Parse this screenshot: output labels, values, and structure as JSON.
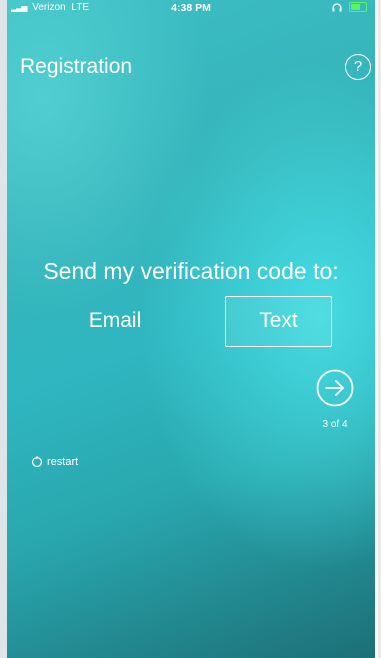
{
  "status_bar": {
    "carrier": "Verizon",
    "network": "LTE",
    "time": "4:38 PM",
    "signal_icon": "signal-bars-icon",
    "headphones_icon": "headphones-icon",
    "battery_icon": "battery-charging-icon"
  },
  "header": {
    "title": "Registration",
    "help_label": "?"
  },
  "main": {
    "prompt": "Send my verification code to:",
    "options": [
      {
        "label": "Email",
        "selected": false
      },
      {
        "label": "Text",
        "selected": true
      }
    ],
    "next_icon": "arrow-right-circle-icon",
    "step": "3 of 4"
  },
  "footer": {
    "restart_icon": "restart-icon",
    "restart_label": "restart"
  },
  "colors": {
    "background_start": "#3dbfc4",
    "background_end": "#1d6f77",
    "text": "#ffffff",
    "battery": "#5cf25c"
  }
}
